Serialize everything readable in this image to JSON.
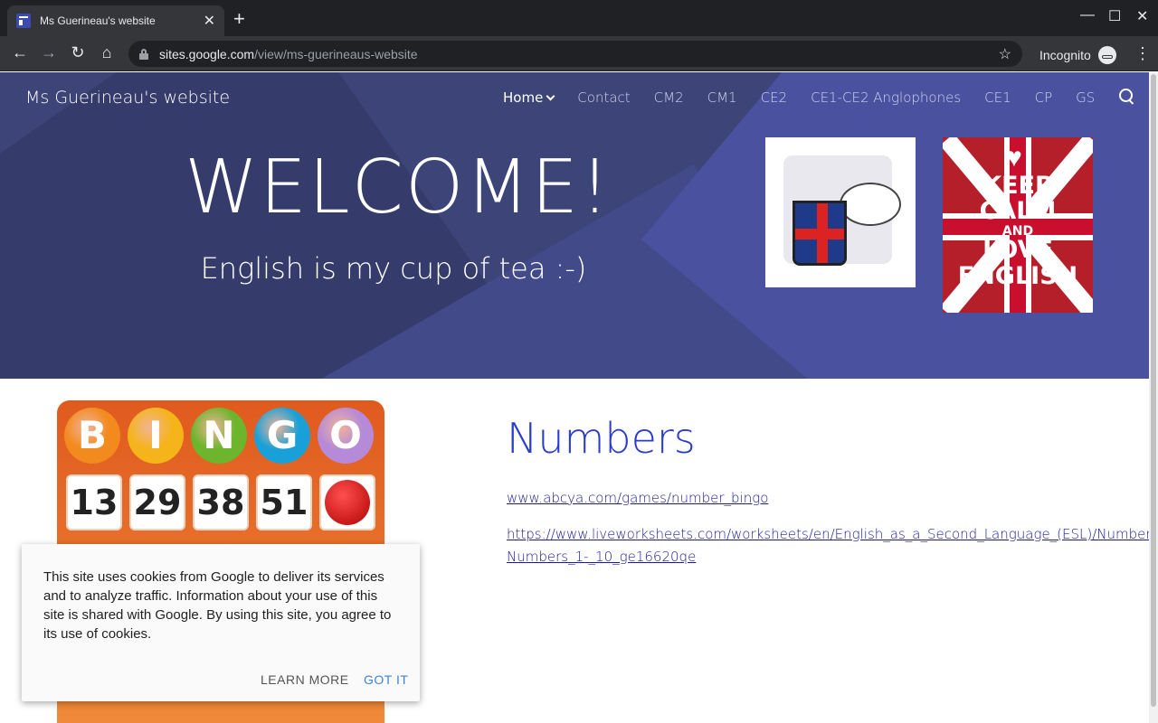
{
  "browser": {
    "tab_title": "Ms Guerineau's website",
    "tab_close": "✕",
    "new_tab": "+",
    "url_host": "sites.google.com",
    "url_path": "/view/ms-guerineaus-website",
    "profile_label": "Incognito",
    "window_controls": {
      "minimize": "—",
      "maximize": "☐",
      "close": "✕"
    }
  },
  "site": {
    "name": "Ms Guerineau's website",
    "nav": [
      {
        "label": "Home",
        "active": true
      },
      {
        "label": "Contact"
      },
      {
        "label": "CM2"
      },
      {
        "label": "CM1"
      },
      {
        "label": "CE2"
      },
      {
        "label": "CE1-CE2 Anglophones"
      },
      {
        "label": "CE1"
      },
      {
        "label": "CP"
      },
      {
        "label": "GS"
      }
    ]
  },
  "hero": {
    "title": "WELCOME!",
    "subtitle": "English is my cup of tea :-)",
    "poster": {
      "line1": "KEEP",
      "line2": "CALM",
      "line3": "AND",
      "line4": "LOVE",
      "line5": "ENGLISH"
    }
  },
  "bingo": {
    "letters": [
      "B",
      "I",
      "N",
      "G",
      "O"
    ],
    "letter_colors": [
      "#f28a1e",
      "#f5b41a",
      "#6cb52d",
      "#1aa0d8",
      "#b58ad8"
    ],
    "row1": [
      "13",
      "29",
      "38",
      "51"
    ]
  },
  "content": {
    "heading": "Numbers",
    "link1": "www.abcya.com/games/number_bingo",
    "link2_line1": "https://www.liveworksheets.com/worksheets/en/English_as_a_Second_Language_(ESL)/Numbers/",
    "link2_line2": "Numbers_1-_10_ge16620qe"
  },
  "cookie": {
    "message": "This site uses cookies from Google to deliver its services and to analyze traffic. Information about your use of this site is shared with Google. By using this site, you agree to its use of cookies.",
    "learn_more": "LEARN MORE",
    "got_it": "GOT IT"
  }
}
